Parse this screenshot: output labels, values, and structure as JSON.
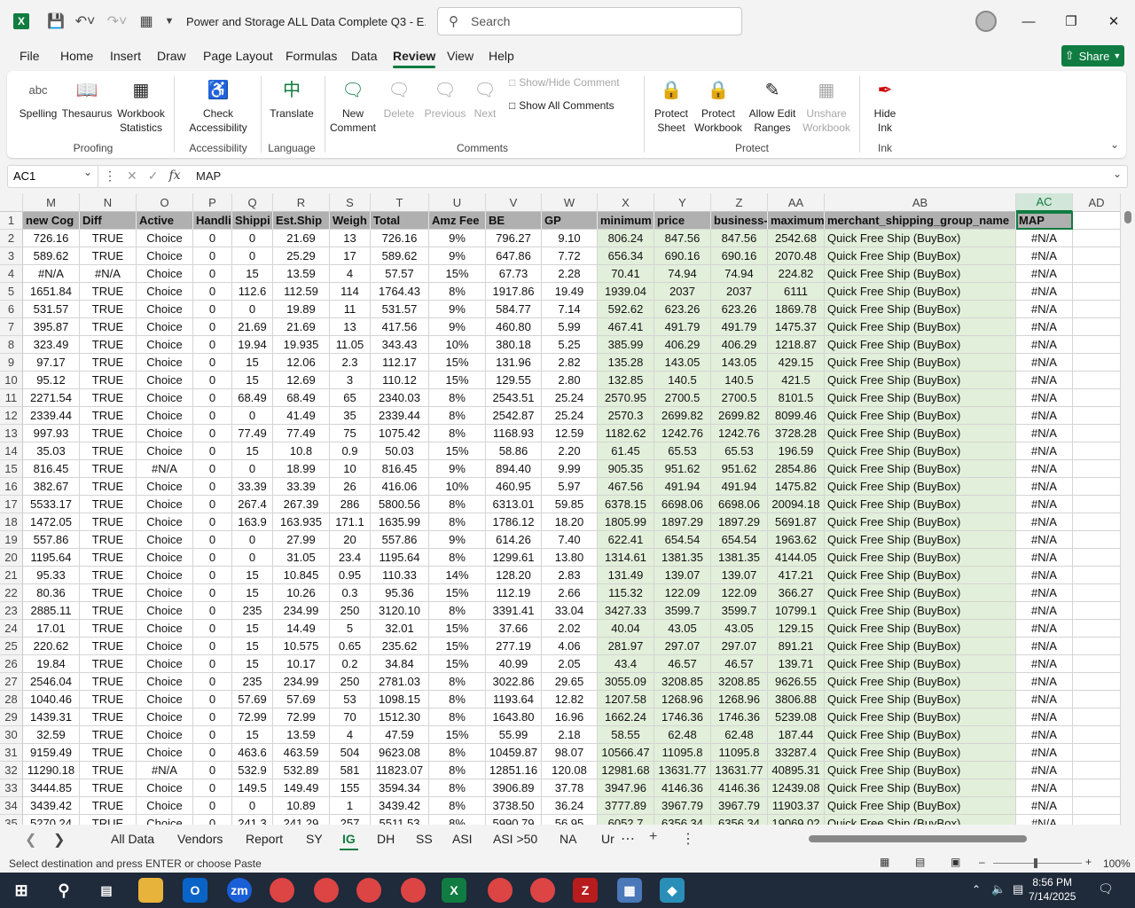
{
  "title": {
    "document": "Power and Storage ALL Data Complete Q3  -  E...",
    "search_placeholder": "Search"
  },
  "menu": {
    "tabs": [
      "File",
      "Home",
      "Insert",
      "Draw",
      "Page Layout",
      "Formulas",
      "Data",
      "Review",
      "View",
      "Help"
    ],
    "active": "Review",
    "share_label": "Share"
  },
  "ribbon": {
    "proofing": {
      "spelling": "Spelling",
      "thesaurus": "Thesaurus",
      "workbook_stats_1": "Workbook",
      "workbook_stats_2": "Statistics",
      "group": "Proofing",
      "spelling_icon_text": "abc"
    },
    "accessibility": {
      "check_1": "Check",
      "check_2": "Accessibility",
      "group": "Accessibility"
    },
    "language": {
      "translate": "Translate",
      "group": "Language"
    },
    "comments": {
      "new_1": "New",
      "new_2": "Comment",
      "delete": "Delete",
      "previous": "Previous",
      "next": "Next",
      "show_hide": "Show/Hide Comment",
      "show_all": "Show All Comments",
      "group": "Comments"
    },
    "protect": {
      "sheet_1": "Protect",
      "sheet_2": "Sheet",
      "workbook_1": "Protect",
      "workbook_2": "Workbook",
      "allow_1": "Allow Edit",
      "allow_2": "Ranges",
      "unshare_1": "Unshare",
      "unshare_2": "Workbook",
      "group": "Protect"
    },
    "ink": {
      "hide_1": "Hide",
      "hide_2": "Ink",
      "group": "Ink"
    }
  },
  "formula_bar": {
    "name_box": "AC1",
    "content": "MAP"
  },
  "columns": [
    "M",
    "N",
    "O",
    "P",
    "Q",
    "R",
    "S",
    "T",
    "U",
    "V",
    "W",
    "X",
    "Y",
    "Z",
    "AA",
    "AB",
    "AC",
    "AD"
  ],
  "headers": [
    "new Cog",
    "Diff",
    "Active",
    "Handli",
    "Shippi",
    "Est.Ship",
    "Weigh",
    "Total",
    "Amz Fee",
    "BE",
    "GP",
    "minimum",
    "price",
    "business-",
    "maximum",
    "merchant_shipping_group_name",
    "MAP"
  ],
  "rows": [
    [
      "726.16",
      "TRUE",
      "Choice",
      "0",
      "0",
      "21.69",
      "13",
      "726.16",
      "9%",
      "796.27",
      "9.10",
      "806.24",
      "847.56",
      "847.56",
      "2542.68",
      "Quick Free Ship (BuyBox)",
      "#N/A"
    ],
    [
      "589.62",
      "TRUE",
      "Choice",
      "0",
      "0",
      "25.29",
      "17",
      "589.62",
      "9%",
      "647.86",
      "7.72",
      "656.34",
      "690.16",
      "690.16",
      "2070.48",
      "Quick Free Ship (BuyBox)",
      "#N/A"
    ],
    [
      "#N/A",
      "#N/A",
      "Choice",
      "0",
      "15",
      "13.59",
      "4",
      "57.57",
      "15%",
      "67.73",
      "2.28",
      "70.41",
      "74.94",
      "74.94",
      "224.82",
      "Quick Free Ship (BuyBox)",
      "#N/A"
    ],
    [
      "1651.84",
      "TRUE",
      "Choice",
      "0",
      "112.6",
      "112.59",
      "114",
      "1764.43",
      "8%",
      "1917.86",
      "19.49",
      "1939.04",
      "2037",
      "2037",
      "6111",
      "Quick Free Ship (BuyBox)",
      "#N/A"
    ],
    [
      "531.57",
      "TRUE",
      "Choice",
      "0",
      "0",
      "19.89",
      "11",
      "531.57",
      "9%",
      "584.77",
      "7.14",
      "592.62",
      "623.26",
      "623.26",
      "1869.78",
      "Quick Free Ship (BuyBox)",
      "#N/A"
    ],
    [
      "395.87",
      "TRUE",
      "Choice",
      "0",
      "21.69",
      "21.69",
      "13",
      "417.56",
      "9%",
      "460.80",
      "5.99",
      "467.41",
      "491.79",
      "491.79",
      "1475.37",
      "Quick Free Ship (BuyBox)",
      "#N/A"
    ],
    [
      "323.49",
      "TRUE",
      "Choice",
      "0",
      "19.94",
      "19.935",
      "11.05",
      "343.43",
      "10%",
      "380.18",
      "5.25",
      "385.99",
      "406.29",
      "406.29",
      "1218.87",
      "Quick Free Ship (BuyBox)",
      "#N/A"
    ],
    [
      "97.17",
      "TRUE",
      "Choice",
      "0",
      "15",
      "12.06",
      "2.3",
      "112.17",
      "15%",
      "131.96",
      "2.82",
      "135.28",
      "143.05",
      "143.05",
      "429.15",
      "Quick Free Ship (BuyBox)",
      "#N/A"
    ],
    [
      "95.12",
      "TRUE",
      "Choice",
      "0",
      "15",
      "12.69",
      "3",
      "110.12",
      "15%",
      "129.55",
      "2.80",
      "132.85",
      "140.5",
      "140.5",
      "421.5",
      "Quick Free Ship (BuyBox)",
      "#N/A"
    ],
    [
      "2271.54",
      "TRUE",
      "Choice",
      "0",
      "68.49",
      "68.49",
      "65",
      "2340.03",
      "8%",
      "2543.51",
      "25.24",
      "2570.95",
      "2700.5",
      "2700.5",
      "8101.5",
      "Quick Free Ship (BuyBox)",
      "#N/A"
    ],
    [
      "2339.44",
      "TRUE",
      "Choice",
      "0",
      "0",
      "41.49",
      "35",
      "2339.44",
      "8%",
      "2542.87",
      "25.24",
      "2570.3",
      "2699.82",
      "2699.82",
      "8099.46",
      "Quick Free Ship (BuyBox)",
      "#N/A"
    ],
    [
      "997.93",
      "TRUE",
      "Choice",
      "0",
      "77.49",
      "77.49",
      "75",
      "1075.42",
      "8%",
      "1168.93",
      "12.59",
      "1182.62",
      "1242.76",
      "1242.76",
      "3728.28",
      "Quick Free Ship (BuyBox)",
      "#N/A"
    ],
    [
      "35.03",
      "TRUE",
      "Choice",
      "0",
      "15",
      "10.8",
      "0.9",
      "50.03",
      "15%",
      "58.86",
      "2.20",
      "61.45",
      "65.53",
      "65.53",
      "196.59",
      "Quick Free Ship (BuyBox)",
      "#N/A"
    ],
    [
      "816.45",
      "TRUE",
      "#N/A",
      "0",
      "0",
      "18.99",
      "10",
      "816.45",
      "9%",
      "894.40",
      "9.99",
      "905.35",
      "951.62",
      "951.62",
      "2854.86",
      "Quick Free Ship (BuyBox)",
      "#N/A"
    ],
    [
      "382.67",
      "TRUE",
      "Choice",
      "0",
      "33.39",
      "33.39",
      "26",
      "416.06",
      "10%",
      "460.95",
      "5.97",
      "467.56",
      "491.94",
      "491.94",
      "1475.82",
      "Quick Free Ship (BuyBox)",
      "#N/A"
    ],
    [
      "5533.17",
      "TRUE",
      "Choice",
      "0",
      "267.4",
      "267.39",
      "286",
      "5800.56",
      "8%",
      "6313.01",
      "59.85",
      "6378.15",
      "6698.06",
      "6698.06",
      "20094.18",
      "Quick Free Ship (BuyBox)",
      "#N/A"
    ],
    [
      "1472.05",
      "TRUE",
      "Choice",
      "0",
      "163.9",
      "163.935",
      "171.1",
      "1635.99",
      "8%",
      "1786.12",
      "18.20",
      "1805.99",
      "1897.29",
      "1897.29",
      "5691.87",
      "Quick Free Ship (BuyBox)",
      "#N/A"
    ],
    [
      "557.86",
      "TRUE",
      "Choice",
      "0",
      "0",
      "27.99",
      "20",
      "557.86",
      "9%",
      "614.26",
      "7.40",
      "622.41",
      "654.54",
      "654.54",
      "1963.62",
      "Quick Free Ship (BuyBox)",
      "#N/A"
    ],
    [
      "1195.64",
      "TRUE",
      "Choice",
      "0",
      "0",
      "31.05",
      "23.4",
      "1195.64",
      "8%",
      "1299.61",
      "13.80",
      "1314.61",
      "1381.35",
      "1381.35",
      "4144.05",
      "Quick Free Ship (BuyBox)",
      "#N/A"
    ],
    [
      "95.33",
      "TRUE",
      "Choice",
      "0",
      "15",
      "10.845",
      "0.95",
      "110.33",
      "14%",
      "128.20",
      "2.83",
      "131.49",
      "139.07",
      "139.07",
      "417.21",
      "Quick Free Ship (BuyBox)",
      "#N/A"
    ],
    [
      "80.36",
      "TRUE",
      "Choice",
      "0",
      "15",
      "10.26",
      "0.3",
      "95.36",
      "15%",
      "112.19",
      "2.66",
      "115.32",
      "122.09",
      "122.09",
      "366.27",
      "Quick Free Ship (BuyBox)",
      "#N/A"
    ],
    [
      "2885.11",
      "TRUE",
      "Choice",
      "0",
      "235",
      "234.99",
      "250",
      "3120.10",
      "8%",
      "3391.41",
      "33.04",
      "3427.33",
      "3599.7",
      "3599.7",
      "10799.1",
      "Quick Free Ship (BuyBox)",
      "#N/A"
    ],
    [
      "17.01",
      "TRUE",
      "Choice",
      "0",
      "15",
      "14.49",
      "5",
      "32.01",
      "15%",
      "37.66",
      "2.02",
      "40.04",
      "43.05",
      "43.05",
      "129.15",
      "Quick Free Ship (BuyBox)",
      "#N/A"
    ],
    [
      "220.62",
      "TRUE",
      "Choice",
      "0",
      "15",
      "10.575",
      "0.65",
      "235.62",
      "15%",
      "277.19",
      "4.06",
      "281.97",
      "297.07",
      "297.07",
      "891.21",
      "Quick Free Ship (BuyBox)",
      "#N/A"
    ],
    [
      "19.84",
      "TRUE",
      "Choice",
      "0",
      "15",
      "10.17",
      "0.2",
      "34.84",
      "15%",
      "40.99",
      "2.05",
      "43.4",
      "46.57",
      "46.57",
      "139.71",
      "Quick Free Ship (BuyBox)",
      "#N/A"
    ],
    [
      "2546.04",
      "TRUE",
      "Choice",
      "0",
      "235",
      "234.99",
      "250",
      "2781.03",
      "8%",
      "3022.86",
      "29.65",
      "3055.09",
      "3208.85",
      "3208.85",
      "9626.55",
      "Quick Free Ship (BuyBox)",
      "#N/A"
    ],
    [
      "1040.46",
      "TRUE",
      "Choice",
      "0",
      "57.69",
      "57.69",
      "53",
      "1098.15",
      "8%",
      "1193.64",
      "12.82",
      "1207.58",
      "1268.96",
      "1268.96",
      "3806.88",
      "Quick Free Ship (BuyBox)",
      "#N/A"
    ],
    [
      "1439.31",
      "TRUE",
      "Choice",
      "0",
      "72.99",
      "72.99",
      "70",
      "1512.30",
      "8%",
      "1643.80",
      "16.96",
      "1662.24",
      "1746.36",
      "1746.36",
      "5239.08",
      "Quick Free Ship (BuyBox)",
      "#N/A"
    ],
    [
      "32.59",
      "TRUE",
      "Choice",
      "0",
      "15",
      "13.59",
      "4",
      "47.59",
      "15%",
      "55.99",
      "2.18",
      "58.55",
      "62.48",
      "62.48",
      "187.44",
      "Quick Free Ship (BuyBox)",
      "#N/A"
    ],
    [
      "9159.49",
      "TRUE",
      "Choice",
      "0",
      "463.6",
      "463.59",
      "504",
      "9623.08",
      "8%",
      "10459.87",
      "98.07",
      "10566.47",
      "11095.8",
      "11095.8",
      "33287.4",
      "Quick Free Ship (BuyBox)",
      "#N/A"
    ],
    [
      "11290.18",
      "TRUE",
      "#N/A",
      "0",
      "532.9",
      "532.89",
      "581",
      "11823.07",
      "8%",
      "12851.16",
      "120.08",
      "12981.68",
      "13631.77",
      "13631.77",
      "40895.31",
      "Quick Free Ship (BuyBox)",
      "#N/A"
    ],
    [
      "3444.85",
      "TRUE",
      "Choice",
      "0",
      "149.5",
      "149.49",
      "155",
      "3594.34",
      "8%",
      "3906.89",
      "37.78",
      "3947.96",
      "4146.36",
      "4146.36",
      "12439.08",
      "Quick Free Ship (BuyBox)",
      "#N/A"
    ],
    [
      "3439.42",
      "TRUE",
      "Choice",
      "0",
      "0",
      "10.89",
      "1",
      "3439.42",
      "8%",
      "3738.50",
      "36.24",
      "3777.89",
      "3967.79",
      "3967.79",
      "11903.37",
      "Quick Free Ship (BuyBox)",
      "#N/A"
    ],
    [
      "5270.24",
      "TRUE",
      "Choice",
      "0",
      "241.3",
      "241.29",
      "257",
      "5511.53",
      "8%",
      "5990.79",
      "56.95",
      "6052.7",
      "6356.34",
      "6356.34",
      "19069.02",
      "Quick Free Ship (BuyBox)",
      "#N/A"
    ]
  ],
  "sheets": [
    "All Data",
    "Vendors",
    "Report",
    "SY",
    "IG",
    "DH",
    "SS",
    "ASI",
    "ASI >50",
    "NA",
    "Ur"
  ],
  "active_sheet": "IG",
  "status": {
    "message": "Select destination and press ENTER or choose Paste",
    "zoom": "100%"
  },
  "clock": {
    "time": "8:56 PM",
    "date": "7/14/2025"
  },
  "colors": {
    "excel_green": "#107c41",
    "header_gray": "#b0b0b0",
    "cell_green": "#e2efda"
  }
}
